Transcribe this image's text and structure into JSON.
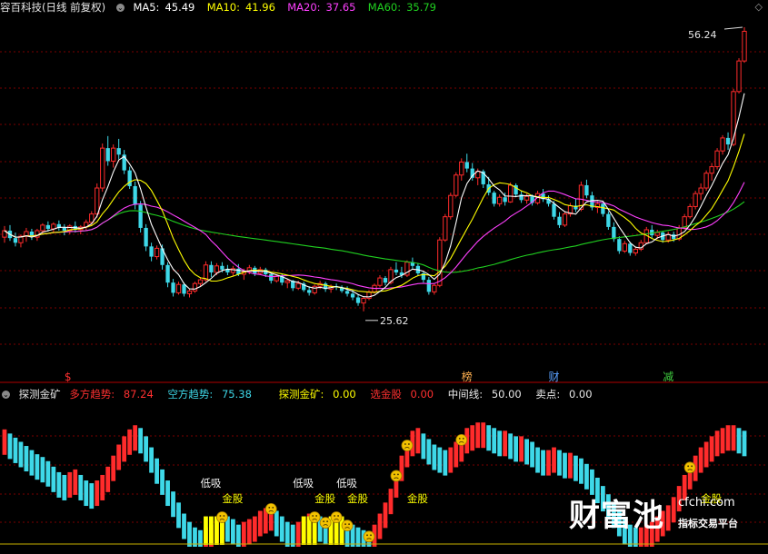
{
  "main_header": {
    "title": "容百科技(日线 前复权)",
    "ma5_label": "MA5:",
    "ma5_value": "45.49",
    "ma10_label": "MA10:",
    "ma10_value": "41.96",
    "ma20_label": "MA20:",
    "ma20_value": "37.65",
    "ma60_label": "MA60:",
    "ma60_value": "35.79"
  },
  "indicator_header": {
    "name": "探测金矿",
    "bull_label": "多方趋势:",
    "bull_value": "87.24",
    "bear_label": "空方趋势:",
    "bear_value": "75.38",
    "probe_label": "探测金矿:",
    "probe_value": "0.00",
    "pick_label": "选金股",
    "pick_value": "0.00",
    "mid_label": "中间线:",
    "mid_value": "50.00",
    "sell_label": "卖点:",
    "sell_value": "0.00"
  },
  "colors": {
    "up": "#ff2b2b",
    "down": "#3ed8e8",
    "ma5": "#ffffff",
    "ma10": "#ffff00",
    "ma20": "#ff40ff",
    "ma60": "#20d020",
    "signal_yellow": "#ffff00",
    "text_label": "#f0f0f0",
    "grid": "#7a0000"
  },
  "watermark": {
    "big": "财富池",
    "url": "cfchi.com",
    "sub": "指标交易平台"
  },
  "chart_data": [
    {
      "type": "candlestick",
      "title": "容百科技(日线 前复权)",
      "price_range": [
        20,
        58
      ],
      "annotations": {
        "high": "56.24",
        "low": "25.62"
      },
      "event_markers": [
        {
          "label": "$",
          "index": 12
        },
        {
          "label": "榜",
          "index": 85
        },
        {
          "label": "财",
          "index": 101
        },
        {
          "label": "减",
          "index": 122
        }
      ],
      "candles": [
        [
          33.6,
          34.8,
          33.0,
          34.3
        ],
        [
          34.3,
          34.9,
          33.2,
          33.5
        ],
        [
          33.5,
          34.1,
          32.6,
          33.0
        ],
        [
          33.0,
          33.9,
          32.5,
          33.7
        ],
        [
          33.7,
          34.6,
          33.1,
          34.2
        ],
        [
          34.2,
          34.5,
          33.3,
          33.6
        ],
        [
          33.6,
          34.5,
          33.2,
          34.3
        ],
        [
          34.3,
          35.1,
          33.9,
          34.9
        ],
        [
          34.9,
          35.3,
          34.2,
          34.5
        ],
        [
          34.5,
          35.2,
          34.0,
          35.0
        ],
        [
          35.0,
          35.4,
          34.3,
          34.6
        ],
        [
          34.6,
          35.0,
          33.8,
          34.3
        ],
        [
          34.3,
          35.0,
          33.9,
          34.8
        ],
        [
          34.8,
          35.3,
          34.1,
          34.4
        ],
        [
          34.4,
          34.9,
          33.9,
          34.7
        ],
        [
          34.7,
          35.5,
          34.3,
          35.2
        ],
        [
          35.2,
          36.4,
          34.9,
          36.1
        ],
        [
          36.1,
          39.4,
          35.7,
          38.9
        ],
        [
          38.9,
          43.7,
          38.5,
          43.2
        ],
        [
          43.2,
          44.5,
          41.3,
          41.8
        ],
        [
          41.8,
          43.6,
          41.1,
          43.2
        ],
        [
          43.2,
          44.2,
          42.0,
          42.5
        ],
        [
          42.5,
          43.0,
          40.4,
          40.8
        ],
        [
          40.8,
          41.2,
          38.8,
          39.1
        ],
        [
          39.1,
          39.6,
          36.6,
          37.1
        ],
        [
          37.1,
          37.5,
          34.1,
          34.6
        ],
        [
          34.6,
          35.0,
          32.1,
          32.6
        ],
        [
          32.6,
          33.0,
          31.0,
          31.5
        ],
        [
          31.5,
          32.7,
          31.2,
          32.4
        ],
        [
          32.4,
          32.8,
          30.1,
          30.6
        ],
        [
          30.6,
          30.9,
          28.2,
          28.7
        ],
        [
          28.7,
          29.1,
          27.2,
          27.6
        ],
        [
          27.6,
          28.8,
          27.4,
          28.5
        ],
        [
          28.5,
          28.7,
          27.2,
          27.5
        ],
        [
          27.5,
          28.0,
          27.1,
          27.8
        ],
        [
          27.8,
          28.8,
          27.6,
          28.6
        ],
        [
          28.6,
          29.3,
          28.3,
          29.0
        ],
        [
          29.0,
          31.0,
          28.8,
          30.6
        ],
        [
          30.6,
          31.0,
          29.3,
          29.8
        ],
        [
          29.8,
          30.8,
          29.5,
          30.5
        ],
        [
          30.5,
          30.9,
          29.8,
          30.1
        ],
        [
          30.1,
          30.6,
          29.5,
          29.8
        ],
        [
          29.8,
          30.5,
          29.4,
          30.2
        ],
        [
          30.2,
          30.7,
          29.4,
          29.6
        ],
        [
          29.6,
          30.2,
          29.0,
          29.9
        ],
        [
          29.9,
          30.6,
          29.6,
          30.3
        ],
        [
          30.3,
          30.5,
          29.4,
          29.7
        ],
        [
          29.7,
          30.4,
          29.5,
          30.1
        ],
        [
          30.1,
          30.3,
          29.3,
          29.6
        ],
        [
          29.6,
          29.8,
          28.6,
          28.9
        ],
        [
          28.9,
          29.6,
          28.7,
          29.4
        ],
        [
          29.4,
          29.6,
          28.4,
          28.7
        ],
        [
          28.7,
          29.1,
          28.1,
          28.9
        ],
        [
          28.9,
          29.0,
          27.8,
          28.1
        ],
        [
          28.1,
          28.9,
          27.9,
          28.6
        ],
        [
          28.6,
          28.8,
          27.7,
          27.9
        ],
        [
          27.9,
          28.3,
          27.3,
          27.6
        ],
        [
          27.6,
          28.5,
          27.4,
          28.3
        ],
        [
          28.3,
          28.9,
          28.0,
          28.6
        ],
        [
          28.6,
          28.8,
          27.7,
          28.0
        ],
        [
          28.0,
          28.5,
          27.6,
          28.3
        ],
        [
          28.3,
          28.6,
          27.9,
          28.2
        ],
        [
          28.2,
          28.4,
          27.6,
          27.8
        ],
        [
          27.8,
          28.3,
          27.2,
          27.5
        ],
        [
          27.5,
          27.9,
          26.8,
          27.1
        ],
        [
          27.1,
          27.4,
          26.2,
          26.5
        ],
        [
          26.5,
          27.2,
          25.6,
          27.0
        ],
        [
          27.0,
          27.9,
          26.8,
          27.7
        ],
        [
          27.7,
          28.6,
          27.5,
          28.4
        ],
        [
          28.4,
          29.5,
          28.2,
          29.2
        ],
        [
          29.2,
          29.4,
          28.4,
          28.7
        ],
        [
          28.7,
          30.4,
          28.5,
          30.1
        ],
        [
          30.1,
          30.9,
          29.5,
          29.8
        ],
        [
          29.8,
          30.4,
          29.2,
          29.5
        ],
        [
          29.5,
          31.1,
          29.3,
          30.9
        ],
        [
          30.9,
          31.4,
          30.2,
          30.5
        ],
        [
          30.5,
          30.8,
          29.4,
          29.7
        ],
        [
          29.7,
          29.9,
          28.7,
          29.0
        ],
        [
          29.0,
          29.3,
          27.4,
          27.7
        ],
        [
          27.7,
          28.6,
          27.4,
          28.4
        ],
        [
          28.4,
          33.6,
          28.2,
          33.3
        ],
        [
          33.3,
          36.1,
          33.1,
          35.8
        ],
        [
          35.8,
          38.4,
          35.5,
          38.1
        ],
        [
          38.1,
          40.6,
          37.9,
          40.3
        ],
        [
          40.3,
          42.1,
          39.7,
          41.7
        ],
        [
          41.7,
          42.6,
          40.6,
          41.0
        ],
        [
          41.0,
          41.6,
          39.7,
          40.0
        ],
        [
          40.0,
          41.0,
          39.2,
          40.7
        ],
        [
          40.7,
          40.9,
          38.9,
          39.3
        ],
        [
          39.3,
          40.1,
          38.1,
          38.4
        ],
        [
          38.4,
          38.6,
          36.9,
          37.2
        ],
        [
          37.2,
          38.2,
          36.9,
          37.9
        ],
        [
          37.9,
          38.4,
          37.0,
          37.4
        ],
        [
          37.4,
          39.5,
          37.3,
          39.2
        ],
        [
          39.2,
          39.4,
          37.9,
          38.2
        ],
        [
          38.2,
          38.6,
          37.3,
          37.6
        ],
        [
          37.6,
          38.3,
          37.2,
          38.0
        ],
        [
          38.0,
          38.2,
          37.0,
          37.3
        ],
        [
          37.3,
          38.6,
          37.1,
          38.3
        ],
        [
          38.3,
          38.8,
          37.4,
          37.7
        ],
        [
          37.7,
          38.1,
          36.9,
          37.2
        ],
        [
          37.2,
          37.5,
          35.5,
          35.8
        ],
        [
          35.8,
          36.3,
          34.6,
          34.9
        ],
        [
          34.9,
          36.4,
          34.7,
          36.1
        ],
        [
          36.1,
          37.3,
          35.8,
          37.0
        ],
        [
          37.0,
          37.7,
          36.3,
          36.6
        ],
        [
          36.6,
          39.6,
          36.4,
          39.2
        ],
        [
          39.2,
          39.8,
          37.8,
          38.1
        ],
        [
          38.1,
          38.5,
          36.5,
          36.8
        ],
        [
          36.8,
          37.5,
          36.2,
          37.2
        ],
        [
          37.2,
          37.3,
          35.8,
          36.1
        ],
        [
          36.1,
          36.4,
          34.4,
          34.7
        ],
        [
          34.7,
          35.2,
          33.1,
          33.4
        ],
        [
          33.4,
          33.7,
          31.8,
          32.1
        ],
        [
          32.1,
          33.2,
          31.9,
          32.9
        ],
        [
          32.9,
          33.1,
          31.6,
          31.9
        ],
        [
          31.9,
          32.6,
          31.6,
          32.3
        ],
        [
          32.3,
          33.3,
          32.1,
          33.0
        ],
        [
          33.0,
          34.7,
          32.9,
          34.4
        ],
        [
          34.4,
          34.9,
          33.5,
          33.8
        ],
        [
          33.8,
          34.4,
          33.4,
          34.1
        ],
        [
          34.1,
          34.3,
          33.0,
          33.3
        ],
        [
          33.3,
          34.2,
          33.0,
          33.9
        ],
        [
          33.9,
          34.2,
          33.1,
          33.4
        ],
        [
          33.4,
          34.9,
          33.2,
          34.6
        ],
        [
          34.6,
          36.1,
          34.4,
          35.8
        ],
        [
          35.8,
          37.2,
          35.6,
          36.9
        ],
        [
          36.9,
          38.6,
          36.6,
          38.3
        ],
        [
          38.3,
          39.4,
          37.6,
          38.9
        ],
        [
          38.9,
          40.8,
          38.6,
          40.5
        ],
        [
          40.5,
          41.6,
          39.7,
          41.2
        ],
        [
          41.2,
          43.2,
          40.9,
          42.9
        ],
        [
          42.9,
          44.6,
          42.5,
          44.3
        ],
        [
          44.3,
          44.9,
          43.0,
          43.6
        ],
        [
          43.6,
          49.6,
          43.4,
          49.3
        ],
        [
          49.3,
          52.9,
          49.1,
          52.6
        ],
        [
          52.6,
          56.24,
          52.4,
          55.8
        ]
      ]
    },
    {
      "type": "bar",
      "title": "探测金矿",
      "midline": 50.0,
      "range": [
        0,
        100
      ],
      "values": [
        85,
        82,
        79,
        76,
        73,
        70,
        67,
        65,
        62,
        58,
        54,
        52,
        54,
        56,
        52,
        48,
        46,
        48,
        52,
        58,
        66,
        74,
        80,
        85,
        88,
        86,
        80,
        72,
        64,
        56,
        48,
        40,
        32,
        24,
        18,
        14,
        12,
        14,
        16,
        22,
        24,
        22,
        20,
        16,
        18,
        20,
        22,
        26,
        28,
        30,
        26,
        22,
        18,
        16,
        18,
        22,
        24,
        24,
        22,
        20,
        22,
        24,
        20,
        18,
        16,
        14,
        12,
        10,
        16,
        24,
        32,
        42,
        54,
        66,
        76,
        84,
        86,
        82,
        78,
        74,
        72,
        70,
        72,
        76,
        80,
        86,
        88,
        90,
        90,
        88,
        86,
        84,
        84,
        82,
        80,
        80,
        78,
        76,
        72,
        70,
        70,
        72,
        70,
        68,
        68,
        66,
        64,
        60,
        56,
        50,
        44,
        38,
        32,
        26,
        20,
        16,
        14,
        14,
        16,
        18,
        22,
        26,
        30,
        36,
        44,
        52,
        60,
        66,
        72,
        76,
        80,
        84,
        86,
        88,
        88,
        86,
        84
      ],
      "labels": [
        {
          "text": "低吸",
          "index": 38,
          "color": "#f0f0f0"
        },
        {
          "text": "金股",
          "index": 42,
          "color": "#ffff00"
        },
        {
          "text": "低吸",
          "index": 55,
          "color": "#f0f0f0"
        },
        {
          "text": "金股",
          "index": 59,
          "color": "#ffff00"
        },
        {
          "text": "低吸",
          "index": 63,
          "color": "#f0f0f0"
        },
        {
          "text": "金股",
          "index": 65,
          "color": "#ffff00"
        },
        {
          "text": "金股",
          "index": 76,
          "color": "#ffff00"
        },
        {
          "text": "金股",
          "index": 130,
          "color": "#ffff00"
        }
      ],
      "signal_columns": [
        37,
        38,
        39,
        40,
        55,
        56,
        57,
        60,
        61,
        62
      ],
      "face_icons": [
        40,
        49,
        57,
        59,
        61,
        63,
        67,
        72,
        74,
        84,
        126
      ]
    }
  ]
}
